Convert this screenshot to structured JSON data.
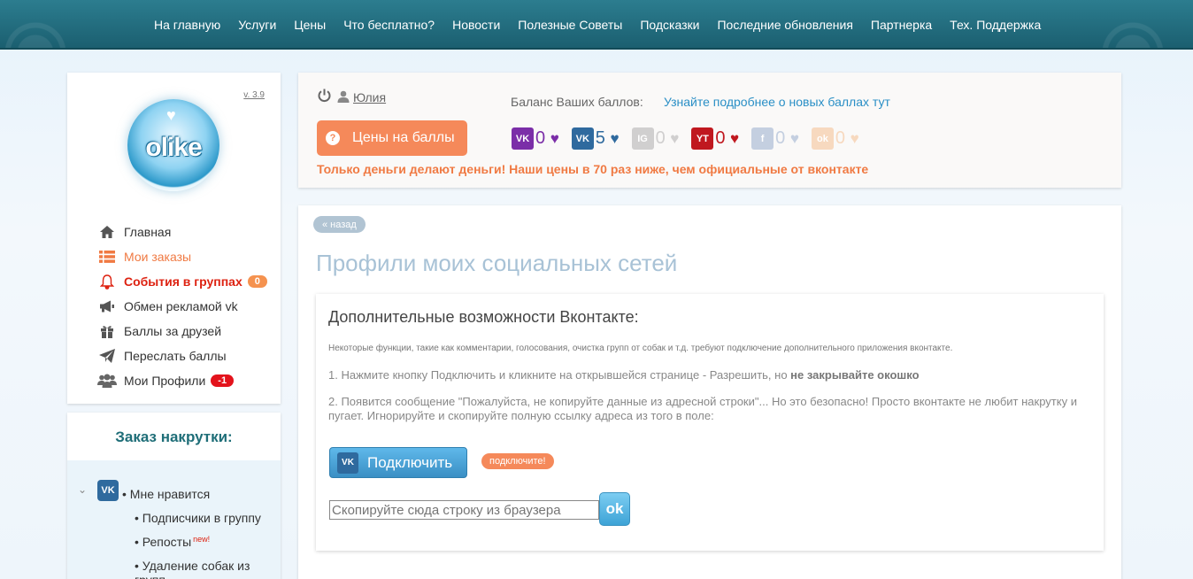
{
  "nav": [
    "На главную",
    "Услуги",
    "Цены",
    "Что бесплатно?",
    "Новости",
    "Полезные Советы",
    "Подсказки",
    "Последние обновления",
    "Партнерка",
    "Тех. Поддержка"
  ],
  "sidebar": {
    "version": "v. 3.9",
    "logo_text": "olike",
    "menu": [
      {
        "label": "Главная",
        "icon": "home-icon"
      },
      {
        "label": "Мои заказы",
        "icon": "list-icon"
      },
      {
        "label": "События в группах",
        "icon": "bell-icon",
        "badge": "0"
      },
      {
        "label": "Обмен рекламой vk",
        "icon": "megaphone-icon"
      },
      {
        "label": "Баллы за друзей",
        "icon": "gift-icon"
      },
      {
        "label": "Переслать баллы",
        "icon": "send-icon"
      },
      {
        "label": "Мои Профили",
        "icon": "users-icon",
        "badge": "-1"
      }
    ],
    "order_title": "Заказ накрутки:",
    "order_items": [
      "Мне нравится",
      "Подписчики в группу",
      "Репосты",
      "Удаление собак из групп"
    ],
    "new_tag": "new!"
  },
  "info": {
    "username": "Юлия",
    "balance_label": "Баланс Ваших баллов:",
    "balance_link": "Узнайте подробнее о новых баллах тут",
    "price_button": "Цены на баллы",
    "points": [
      {
        "network": "vk-vip",
        "icon": "VK",
        "value": "0",
        "color": "#7b2ea8"
      },
      {
        "network": "vk",
        "icon": "VK",
        "value": "5",
        "color": "#2f6a9e"
      },
      {
        "network": "instagram",
        "icon": "IG",
        "value": "0",
        "color": "#d0cfcf"
      },
      {
        "network": "youtube",
        "icon": "YT",
        "value": "0",
        "color": "#c0181f"
      },
      {
        "network": "facebook",
        "icon": "f",
        "value": "0",
        "color": "#c4cfe0"
      },
      {
        "network": "odnoklassniki",
        "icon": "ok",
        "value": "0",
        "color": "#f7d9bf"
      }
    ],
    "heart": "♥",
    "slogan": "Только деньги делают деньги! Наши цены в 70 раз ниже, чем официальные от вконтакте"
  },
  "main": {
    "back": "« назад",
    "title": "Профили моих социальных сетей",
    "section_title": "Дополнительные возможности Вконтакте:",
    "note": "Некоторые функции, такие как комментарии, голосования, очистка групп от собак и т.д. требуют подключение дополнительного приложения вконтакте.",
    "step1_text": "1. Нажмите кнопку Подключить и кликните на открывшейся странице - Разрешить, но ",
    "step1_bold": "не закрывайте окошко",
    "step2": "2. Появится сообщение \"Пожалуйста, не копируйте данные из адресной строки\"... Но это безопасно! Просто вконтакте не любит накрутку и пугает. Игнорируйте и скопируйте полную ссылку адреса из того в поле:",
    "connect_button": "Подключить",
    "connect_tag": "подключите!",
    "input_placeholder": "Скопируйте сюда строку из браузера",
    "ok_button": "ok"
  }
}
